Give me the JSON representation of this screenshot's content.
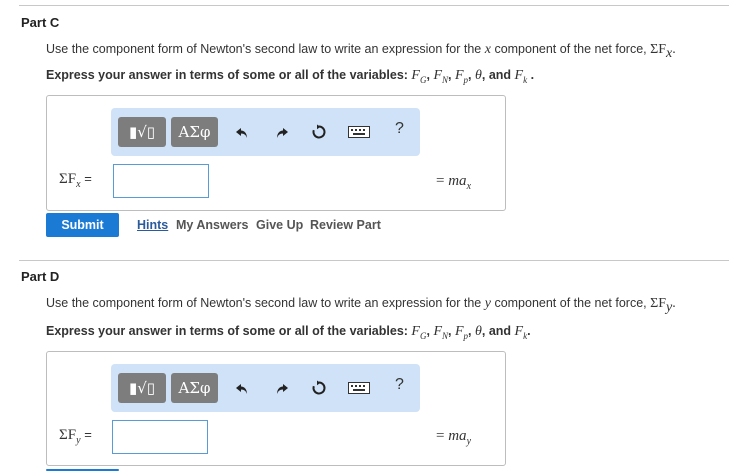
{
  "partC": {
    "title": "Part C",
    "question_text": "Use the component form of Newton's second law to write an expression for the",
    "question_axis": "x",
    "question_text2": "component of the net force,",
    "question_sym": "ΣF",
    "question_sub": "x",
    "instruction_prefix": "Express your answer in terms of some or all of the variables:",
    "instruction_suffix": ", and",
    "vars": {
      "fg": "F",
      "fg_sub": "G",
      "fn": "F",
      "fn_sub": "N",
      "fp": "F",
      "fp_sub": "p",
      "theta": "θ",
      "fk": "F",
      "fk_sub": "k"
    },
    "lhs_sym": "ΣF",
    "lhs_sub": "x",
    "lhs_eq": "=",
    "input_value": "",
    "rhs_eq": "=",
    "rhs_m": "ma",
    "rhs_sub": "x",
    "submit_label": "Submit",
    "hints_label": "Hints",
    "my_answers_label": "My Answers",
    "give_up_label": "Give Up",
    "review_part_label": "Review Part"
  },
  "partD": {
    "title": "Part D",
    "question_text": "Use the component form of Newton's second law to write an expression for the",
    "question_axis": "y",
    "question_text2": "component of the net force,",
    "question_sym": "ΣF",
    "question_sub": "y",
    "instruction_prefix": "Express your answer in terms of some or all of the variables:",
    "instruction_suffix": ", and",
    "vars": {
      "fg": "F",
      "fg_sub": "G",
      "fn": "F",
      "fn_sub": "N",
      "fp": "F",
      "fp_sub": "p",
      "theta": "θ",
      "fk": "F",
      "fk_sub": "k"
    },
    "lhs_sym": "ΣF",
    "lhs_sub": "y",
    "lhs_eq": "=",
    "input_value": "",
    "rhs_eq": "=",
    "rhs_m": "ma",
    "rhs_sub": "y"
  },
  "toolbar": {
    "template_label": "▮√▯",
    "greek_label": "ΑΣφ",
    "help_label": "?",
    "icons": [
      "undo-icon",
      "redo-icon",
      "reset-icon",
      "keyboard-icon"
    ]
  },
  "colors": {
    "toolbar_bg": "#cfe2f7",
    "submit_bg": "#1a7ad4",
    "input_border": "#5b9bd5"
  }
}
